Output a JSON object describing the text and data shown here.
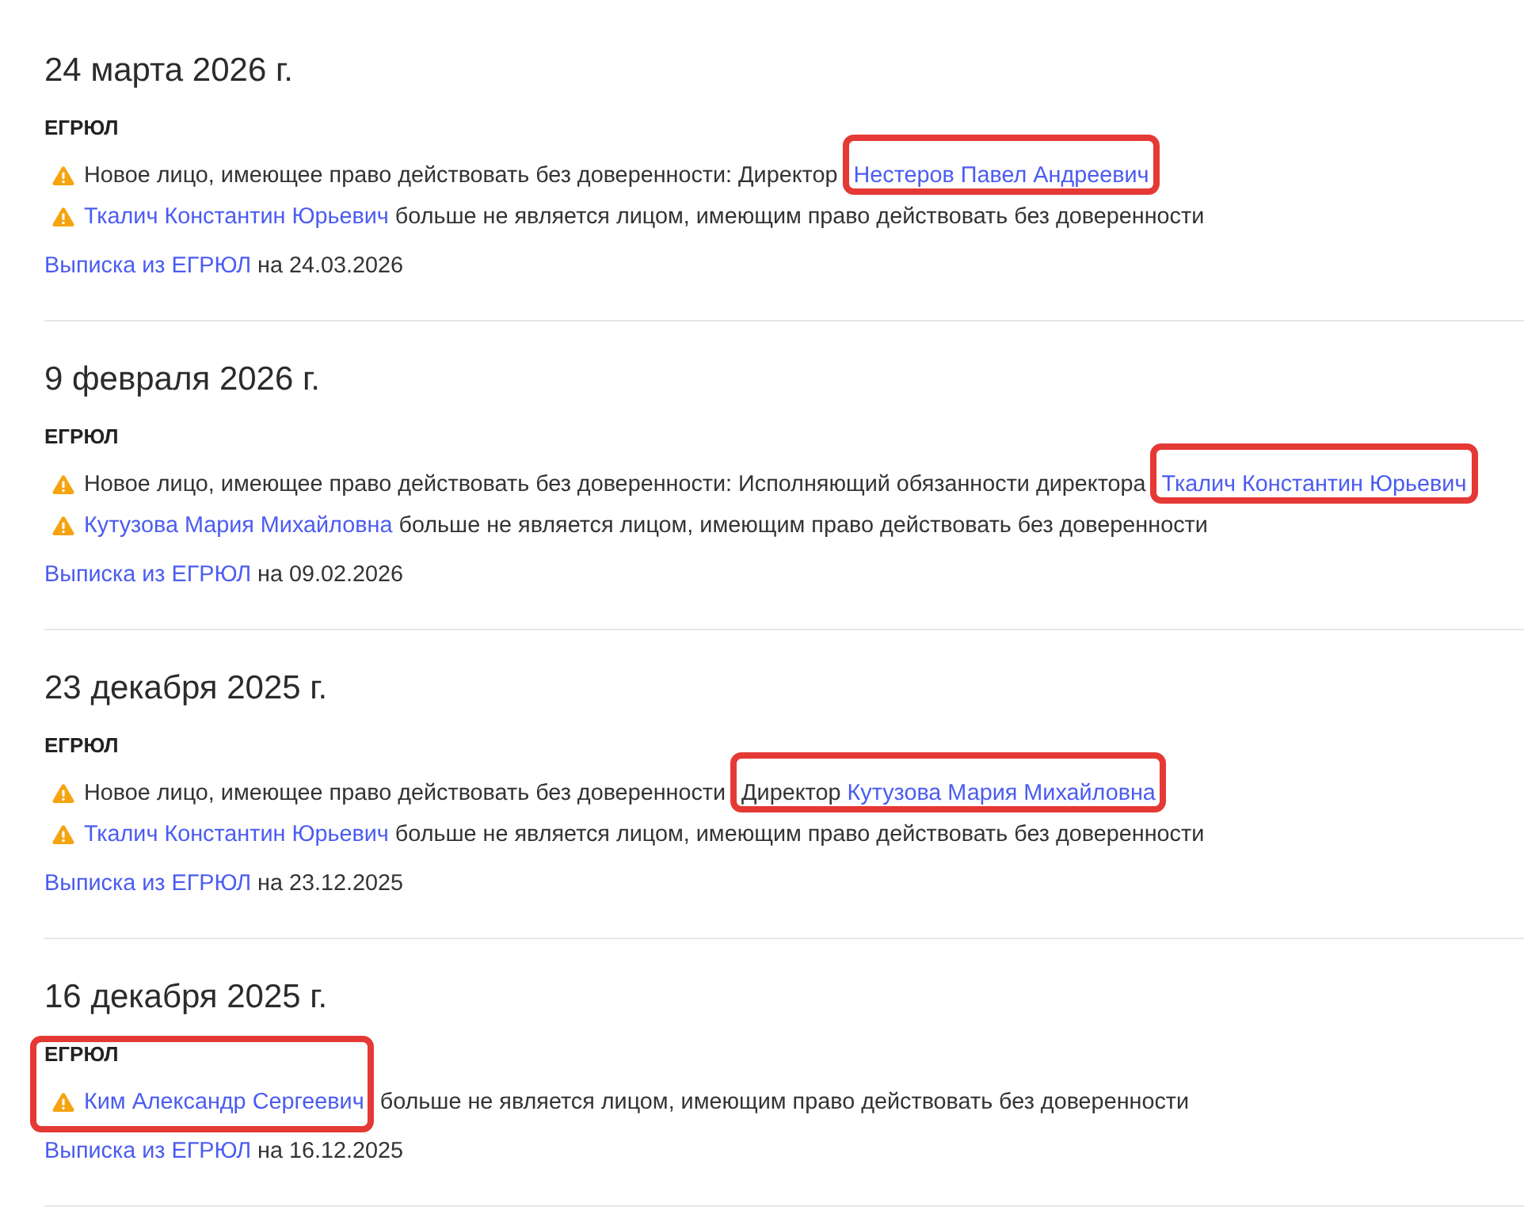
{
  "events": [
    {
      "date": "24 марта 2026 г.",
      "source": {
        "label": "ЕГРЮЛ",
        "highlighted": false
      },
      "changes": [
        {
          "kind": "warning",
          "segments": [
            {
              "kind": "text",
              "text": "Новое лицо, имеющее право действовать без доверенности: Директор",
              "highlighted": false
            },
            {
              "kind": "link",
              "text": "Нестеров Павел Андреевич",
              "highlighted": true
            }
          ]
        },
        {
          "kind": "warning",
          "segments": [
            {
              "kind": "link",
              "text": "Ткалич Константин Юрьевич",
              "highlighted": false
            },
            {
              "kind": "text",
              "text": "больше не является лицом, имеющим право действовать без доверенности",
              "highlighted": false
            }
          ]
        }
      ],
      "extract": {
        "link": "Выписка из ЕГРЮЛ",
        "text": "на 24.03.2026"
      }
    },
    {
      "date": "9 февраля 2026 г.",
      "source": {
        "label": "ЕГРЮЛ",
        "highlighted": false
      },
      "changes": [
        {
          "kind": "warning",
          "segments": [
            {
              "kind": "text",
              "text": "Новое лицо, имеющее право действовать без доверенности: Исполняющий обязанности директора",
              "highlighted": false
            },
            {
              "kind": "link",
              "text": "Ткалич Константин Юрьевич",
              "highlighted": true
            }
          ]
        },
        {
          "kind": "warning",
          "segments": [
            {
              "kind": "link",
              "text": "Кутузова Мария Михайловна",
              "highlighted": false
            },
            {
              "kind": "text",
              "text": "больше не является лицом, имеющим право действовать без доверенности",
              "highlighted": false
            }
          ]
        }
      ],
      "extract": {
        "link": "Выписка из ЕГРЮЛ",
        "text": "на 09.02.2026"
      }
    },
    {
      "date": "23 декабря 2025 г.",
      "source": {
        "label": "ЕГРЮЛ",
        "highlighted": false
      },
      "changes": [
        {
          "kind": "warning",
          "segments": [
            {
              "kind": "text",
              "text": "Новое лицо, имеющее право действовать без доверенности",
              "highlighted": false
            },
            {
              "kind": "text",
              "text": "Директор",
              "highlighted": true
            },
            {
              "kind": "link",
              "text": "Кутузова Мария Михайловна",
              "highlighted": true
            }
          ]
        },
        {
          "kind": "warning",
          "segments": [
            {
              "kind": "link",
              "text": "Ткалич Константин Юрьевич",
              "highlighted": false
            },
            {
              "kind": "text",
              "text": "больше не является лицом, имеющим право действовать без доверенности",
              "highlighted": false
            }
          ]
        }
      ],
      "extract": {
        "link": "Выписка из ЕГРЮЛ",
        "text": "на 23.12.2025"
      }
    },
    {
      "date": "16 декабря 2025 г.",
      "source": {
        "label": "ЕГРЮЛ",
        "highlighted": true
      },
      "changes": [
        {
          "kind": "warning",
          "segments": [
            {
              "kind": "link",
              "text": "Ким Александр Сергеевич",
              "highlighted": true
            },
            {
              "kind": "text",
              "text": "больше не является лицом, имеющим право действовать без доверенности",
              "highlighted": false
            }
          ]
        }
      ],
      "extract": {
        "link": "Выписка из ЕГРЮЛ",
        "text": "на 16.12.2025"
      }
    }
  ]
}
